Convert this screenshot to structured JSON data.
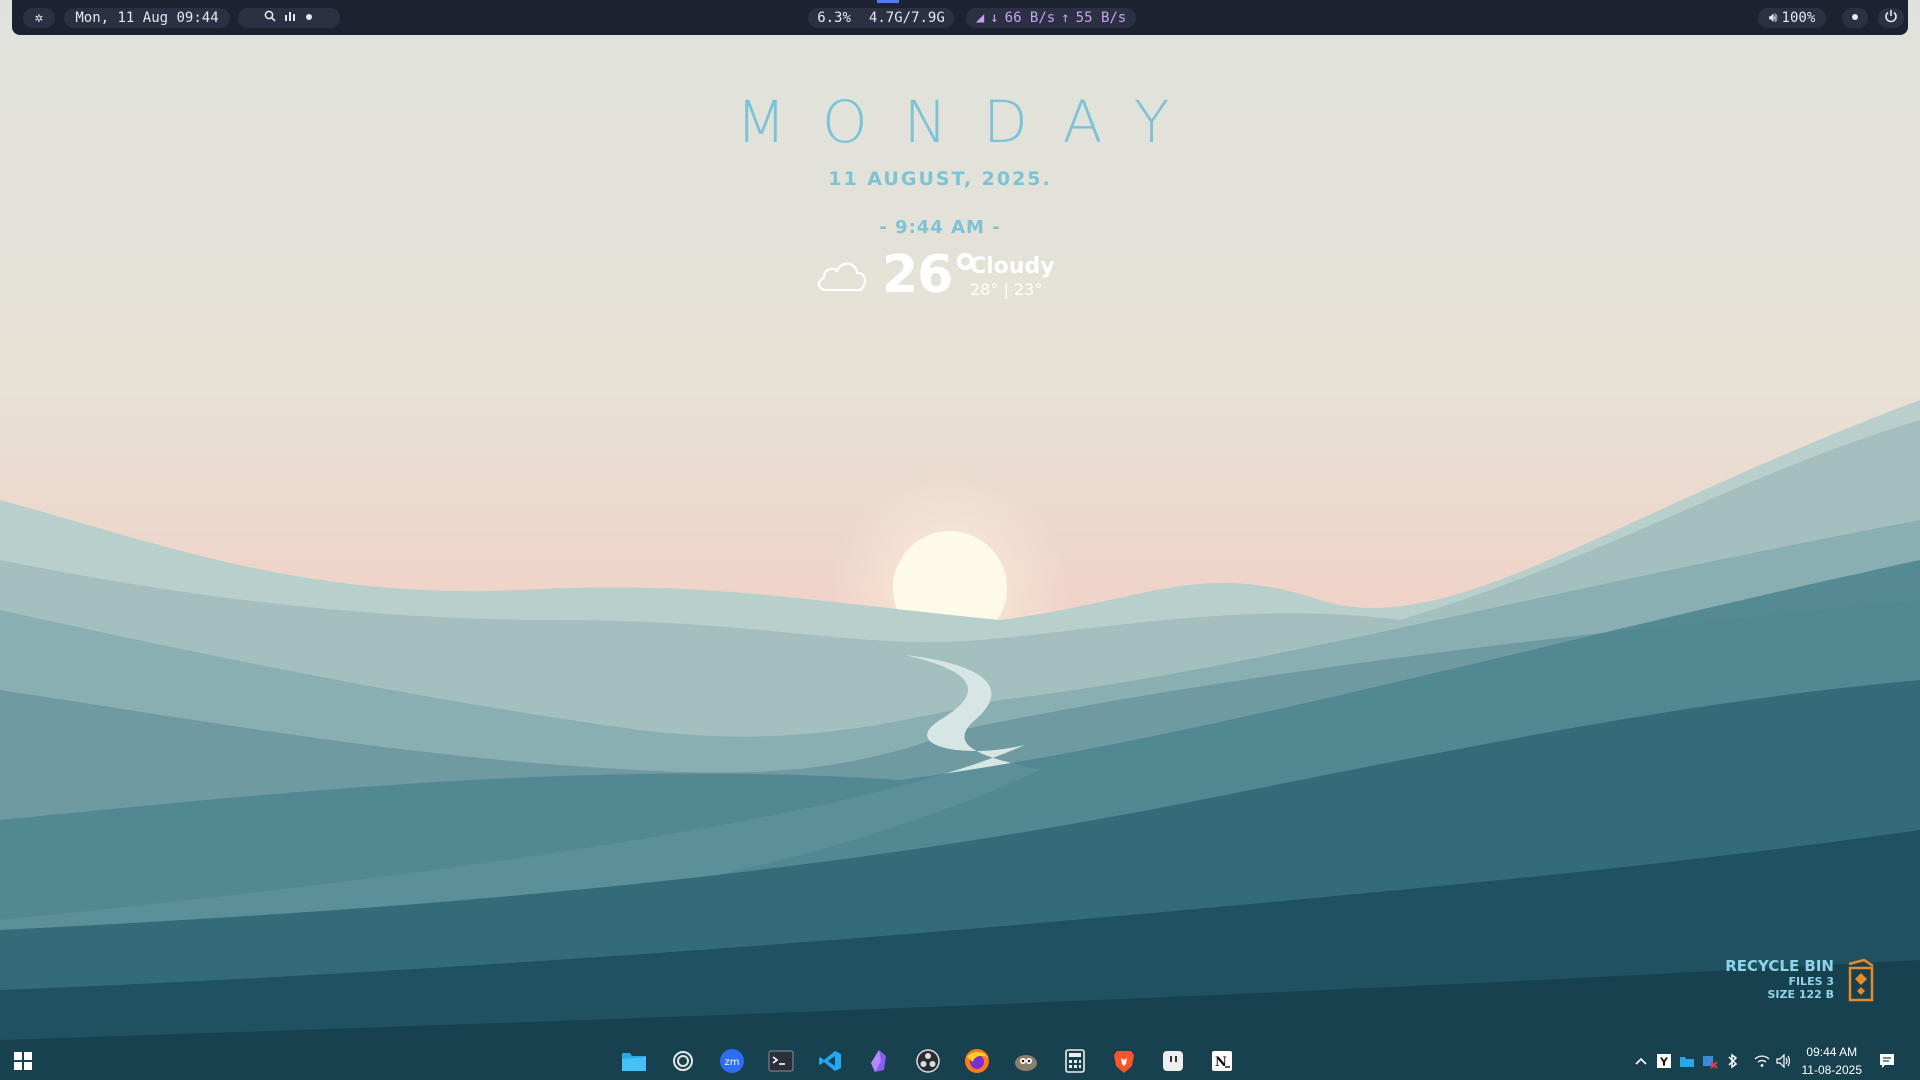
{
  "topbar": {
    "datetime": "Mon, 11 Aug 09:44",
    "cpu": "6.3%",
    "memory": "4.7G/7.9G",
    "net_down": "66 B/s",
    "net_up": "55 B/s",
    "volume": "100%",
    "icons": [
      "settings-icon",
      "search-icon",
      "chart-icon",
      "dot-icon",
      "settings-icon",
      "power-icon"
    ]
  },
  "widget": {
    "day": "MONDAY",
    "date": "11 AUGUST, 2025.",
    "time": "- 9:44 AM -",
    "temperature": "26°",
    "condition": "Cloudy",
    "hilo": "28° | 23°",
    "weather_icon": "cloud-icon"
  },
  "recycle_bin": {
    "title": "RECYCLE BIN",
    "files": "FILES 3",
    "size": "SIZE 122 B"
  },
  "taskbar": {
    "apps": [
      "start-icon",
      "file-explorer-icon",
      "obs-circle-icon",
      "zoom-icon",
      "terminal-icon",
      "vscode-icon",
      "obsidian-icon",
      "obs-studio-icon",
      "firefox-icon",
      "gimp-icon",
      "calculator-icon",
      "brave-icon",
      "twitch-icon",
      "notion-icon"
    ],
    "zoom_label": "zm",
    "tray_icons": [
      "chevron-up-icon",
      "y-icon",
      "app-icon",
      "app-icon",
      "bluetooth-icon",
      "wifi-icon",
      "volume-icon"
    ],
    "clock_time": "09:44 AM",
    "clock_date": "11-08-2025",
    "notification_icon": "notification-icon"
  },
  "colors": {
    "accent": "#7cc3d6",
    "bar_bg": "#1d2230",
    "pill_bg": "#2b3142",
    "net_purple": "#c8a2f0"
  }
}
